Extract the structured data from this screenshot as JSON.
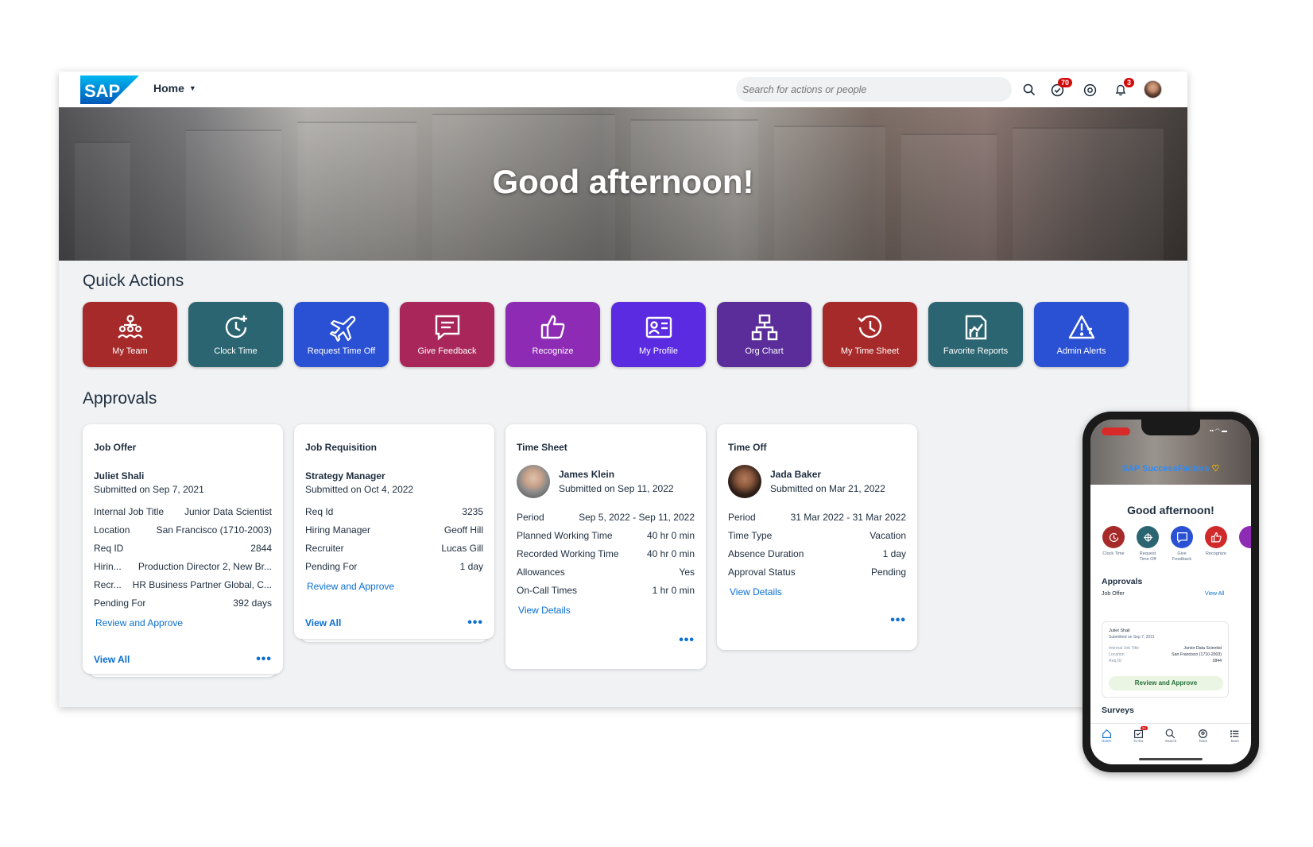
{
  "topbar": {
    "logo_text": "SAP",
    "home_label": "Home",
    "search_placeholder": "Search for actions or people",
    "todo_badge": "70",
    "notifications_badge": "3"
  },
  "hero": {
    "greeting": "Good afternoon!"
  },
  "quick_actions": {
    "title": "Quick Actions",
    "items": [
      {
        "label": "My Team",
        "color": "#a72a2a",
        "icon": "team-icon"
      },
      {
        "label": "Clock Time",
        "color": "#2b6571",
        "icon": "clock-time-icon"
      },
      {
        "label": "Request Time Off",
        "color": "#2a50d3",
        "icon": "airplane-icon"
      },
      {
        "label": "Give Feedback",
        "color": "#a9265a",
        "icon": "feedback-icon"
      },
      {
        "label": "Recognize",
        "color": "#8e2bb5",
        "icon": "thumbs-up-icon"
      },
      {
        "label": "My Profile",
        "color": "#5a2be0",
        "icon": "profile-card-icon"
      },
      {
        "label": "Org Chart",
        "color": "#5a2d9a",
        "icon": "org-chart-icon"
      },
      {
        "label": "My Time Sheet",
        "color": "#a72a2a",
        "icon": "history-icon"
      },
      {
        "label": "Favorite Reports",
        "color": "#2b6571",
        "icon": "report-icon"
      },
      {
        "label": "Admin Alerts",
        "color": "#2a50d3",
        "icon": "alert-icon"
      }
    ]
  },
  "approvals": {
    "title": "Approvals",
    "job_offer": {
      "type": "Job Offer",
      "name": "Juliet Shali",
      "submitted": "Submitted on Sep 7, 2021",
      "rows": [
        [
          "Internal Job Title",
          "Junior Data Scientist"
        ],
        [
          "Location",
          "San Francisco (1710-2003)"
        ],
        [
          "Req ID",
          "2844"
        ],
        [
          "Hirin...",
          "Production Director 2, New Br..."
        ],
        [
          "Recr...",
          "HR Business Partner Global, C..."
        ],
        [
          "Pending For",
          "392 days"
        ]
      ],
      "action": "Review and Approve",
      "view_all": "View All"
    },
    "job_requisition": {
      "type": "Job Requisition",
      "name": "Strategy Manager",
      "submitted": "Submitted on Oct 4, 2022",
      "rows": [
        [
          "Req Id",
          "3235"
        ],
        [
          "Hiring Manager",
          "Geoff Hill"
        ],
        [
          "Recruiter",
          "Lucas Gill"
        ],
        [
          "Pending For",
          "1 day"
        ]
      ],
      "action": "Review and Approve",
      "view_all": "View All"
    },
    "time_sheet": {
      "type": "Time Sheet",
      "name": "James Klein",
      "submitted": "Submitted on Sep 11, 2022",
      "rows": [
        [
          "Period",
          "Sep 5, 2022 - Sep 11, 2022"
        ],
        [
          "Planned Working Time",
          "40 hr 0 min"
        ],
        [
          "Recorded Working Time",
          "40 hr 0 min"
        ],
        [
          "Allowances",
          "Yes"
        ],
        [
          "On-Call Times",
          "1 hr 0 min"
        ]
      ],
      "action": "View Details"
    },
    "time_off": {
      "type": "Time Off",
      "name": "Jada Baker",
      "submitted": "Submitted on Mar 21, 2022",
      "rows": [
        [
          "Period",
          "31 Mar 2022 - 31 Mar 2022"
        ],
        [
          "Time Type",
          "Vacation"
        ],
        [
          "Absence Duration",
          "1 day"
        ],
        [
          "Approval Status",
          "Pending"
        ]
      ],
      "action": "View Details"
    }
  },
  "phone": {
    "app_title": "SAP SuccessFactors",
    "greeting": "Good afternoon!",
    "quick_actions": [
      {
        "label": "Clock Time",
        "color": "#a72a2a"
      },
      {
        "label": "Request Time Off",
        "color": "#2b6571"
      },
      {
        "label": "Give Feedback",
        "color": "#2a50d3"
      },
      {
        "label": "Recognize",
        "color": "#d12a2a"
      }
    ],
    "approvals_title": "Approvals",
    "job_offer_label": "Job Offer",
    "view_all": "View All",
    "card": {
      "name": "Juliet Shali",
      "submitted": "Submitted on Sep 7, 2021",
      "rows": [
        [
          "Internal Job Title",
          "Junior Data Scientist"
        ],
        [
          "Location",
          "San Francisco (1710-2003)"
        ],
        [
          "Req ID",
          "2844"
        ]
      ],
      "action": "Review and Approve"
    },
    "surveys_title": "Surveys",
    "nav": [
      "Home",
      "To-Do",
      "Search",
      "Team",
      "More"
    ],
    "todo_badge": "24"
  }
}
